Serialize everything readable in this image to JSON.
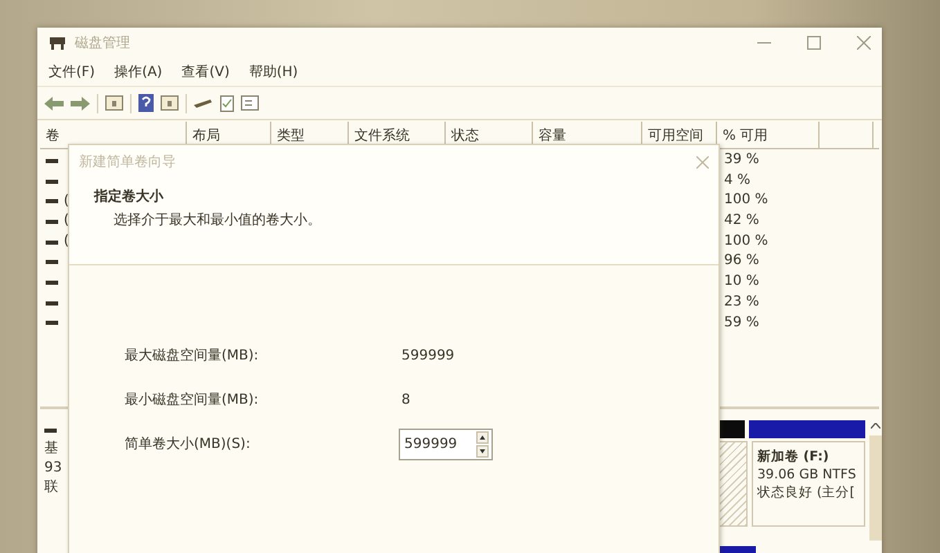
{
  "window": {
    "title": "磁盘管理",
    "menu": [
      "文件(F)",
      "操作(A)",
      "查看(V)",
      "帮助(H)"
    ]
  },
  "volume_table": {
    "columns": [
      "卷",
      "布局",
      "类型",
      "文件系统",
      "状态",
      "容量",
      "可用空间",
      "% 可用"
    ],
    "rows": [
      {
        "percent_free": "39 %"
      },
      {
        "percent_free": "4 %"
      },
      {
        "volume": "(",
        "percent_free": "100 %"
      },
      {
        "volume": "(",
        "percent_free": "42 %"
      },
      {
        "volume": "(",
        "percent_free": "100 %"
      },
      {
        "percent_free": "96 %"
      },
      {
        "percent_free": "10 %"
      },
      {
        "percent_free": "23 %"
      },
      {
        "percent_free": "59 %"
      }
    ]
  },
  "disk_pane": {
    "disk_labels": [
      "基",
      "93",
      "联"
    ],
    "partition": {
      "name": "新加卷  (F:)",
      "size": "39.06 GB NTFS",
      "status": "状态良好 (主分["
    }
  },
  "dialog": {
    "title": "新建简单卷向导",
    "heading": "指定卷大小",
    "subtitle": "选择介于最大和最小值的卷大小。",
    "fields": [
      {
        "kind": "readout",
        "label": "最大磁盘空间量(MB):",
        "value": "599999"
      },
      {
        "kind": "readout",
        "label": "最小磁盘空间量(MB):",
        "value": "8"
      },
      {
        "kind": "spinner",
        "label": "简单卷大小(MB)(S):",
        "value": "599999"
      }
    ]
  }
}
